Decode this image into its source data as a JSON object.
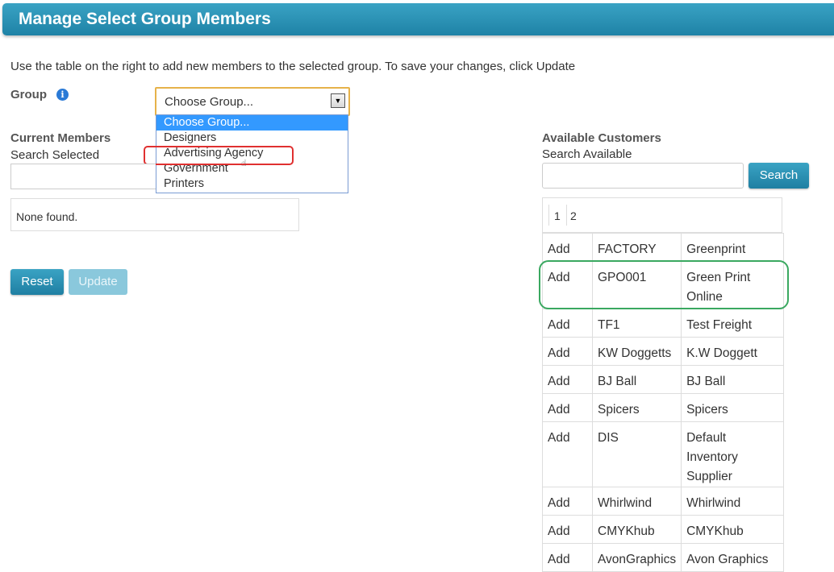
{
  "header": {
    "title": "Manage Select Group Members"
  },
  "intro_text": "Use the table on the right to add new members to the selected group. To save your changes, click Update",
  "group": {
    "label": "Group",
    "info_icon": "i",
    "selected_value": "Choose Group...",
    "options": [
      "Choose Group...",
      "Designers",
      "Advertising Agency",
      "Government",
      "Printers"
    ],
    "highlighted_option": "Choose Group..."
  },
  "current_members": {
    "title": "Current Members",
    "search_label": "Search Selected",
    "search_value": "",
    "empty_text": "None found."
  },
  "buttons": {
    "reset": "Reset",
    "update": "Update",
    "search": "Search"
  },
  "available_customers": {
    "title": "Available Customers",
    "search_label": "Search Available",
    "search_value": "",
    "pages": [
      "1",
      "2"
    ],
    "rows": [
      {
        "action": "Add",
        "code": "FACTORY",
        "name": "Greenprint"
      },
      {
        "action": "Add",
        "code": "GPO001",
        "name": "Green Print Online"
      },
      {
        "action": "Add",
        "code": "TF1",
        "name": "Test Freight"
      },
      {
        "action": "Add",
        "code": "KW Doggetts",
        "name": "K.W Doggett"
      },
      {
        "action": "Add",
        "code": "BJ Ball",
        "name": "BJ Ball"
      },
      {
        "action": "Add",
        "code": "Spicers",
        "name": "Spicers"
      },
      {
        "action": "Add",
        "code": "DIS",
        "name": "Default Inventory Supplier"
      },
      {
        "action": "Add",
        "code": "Whirlwind",
        "name": "Whirlwind"
      },
      {
        "action": "Add",
        "code": "CMYKhub",
        "name": "CMYKhub"
      },
      {
        "action": "Add",
        "code": "AvonGraphics",
        "name": "Avon Graphics"
      }
    ]
  },
  "colors": {
    "header_bg": "#2691b5",
    "button_bg": "#2b93b8",
    "disabled_button_bg": "#8ac8dc",
    "selected_option_bg": "#3399ff",
    "red_annotation": "#e03030",
    "green_annotation": "#3aa860",
    "select_border": "#e6b24a"
  }
}
